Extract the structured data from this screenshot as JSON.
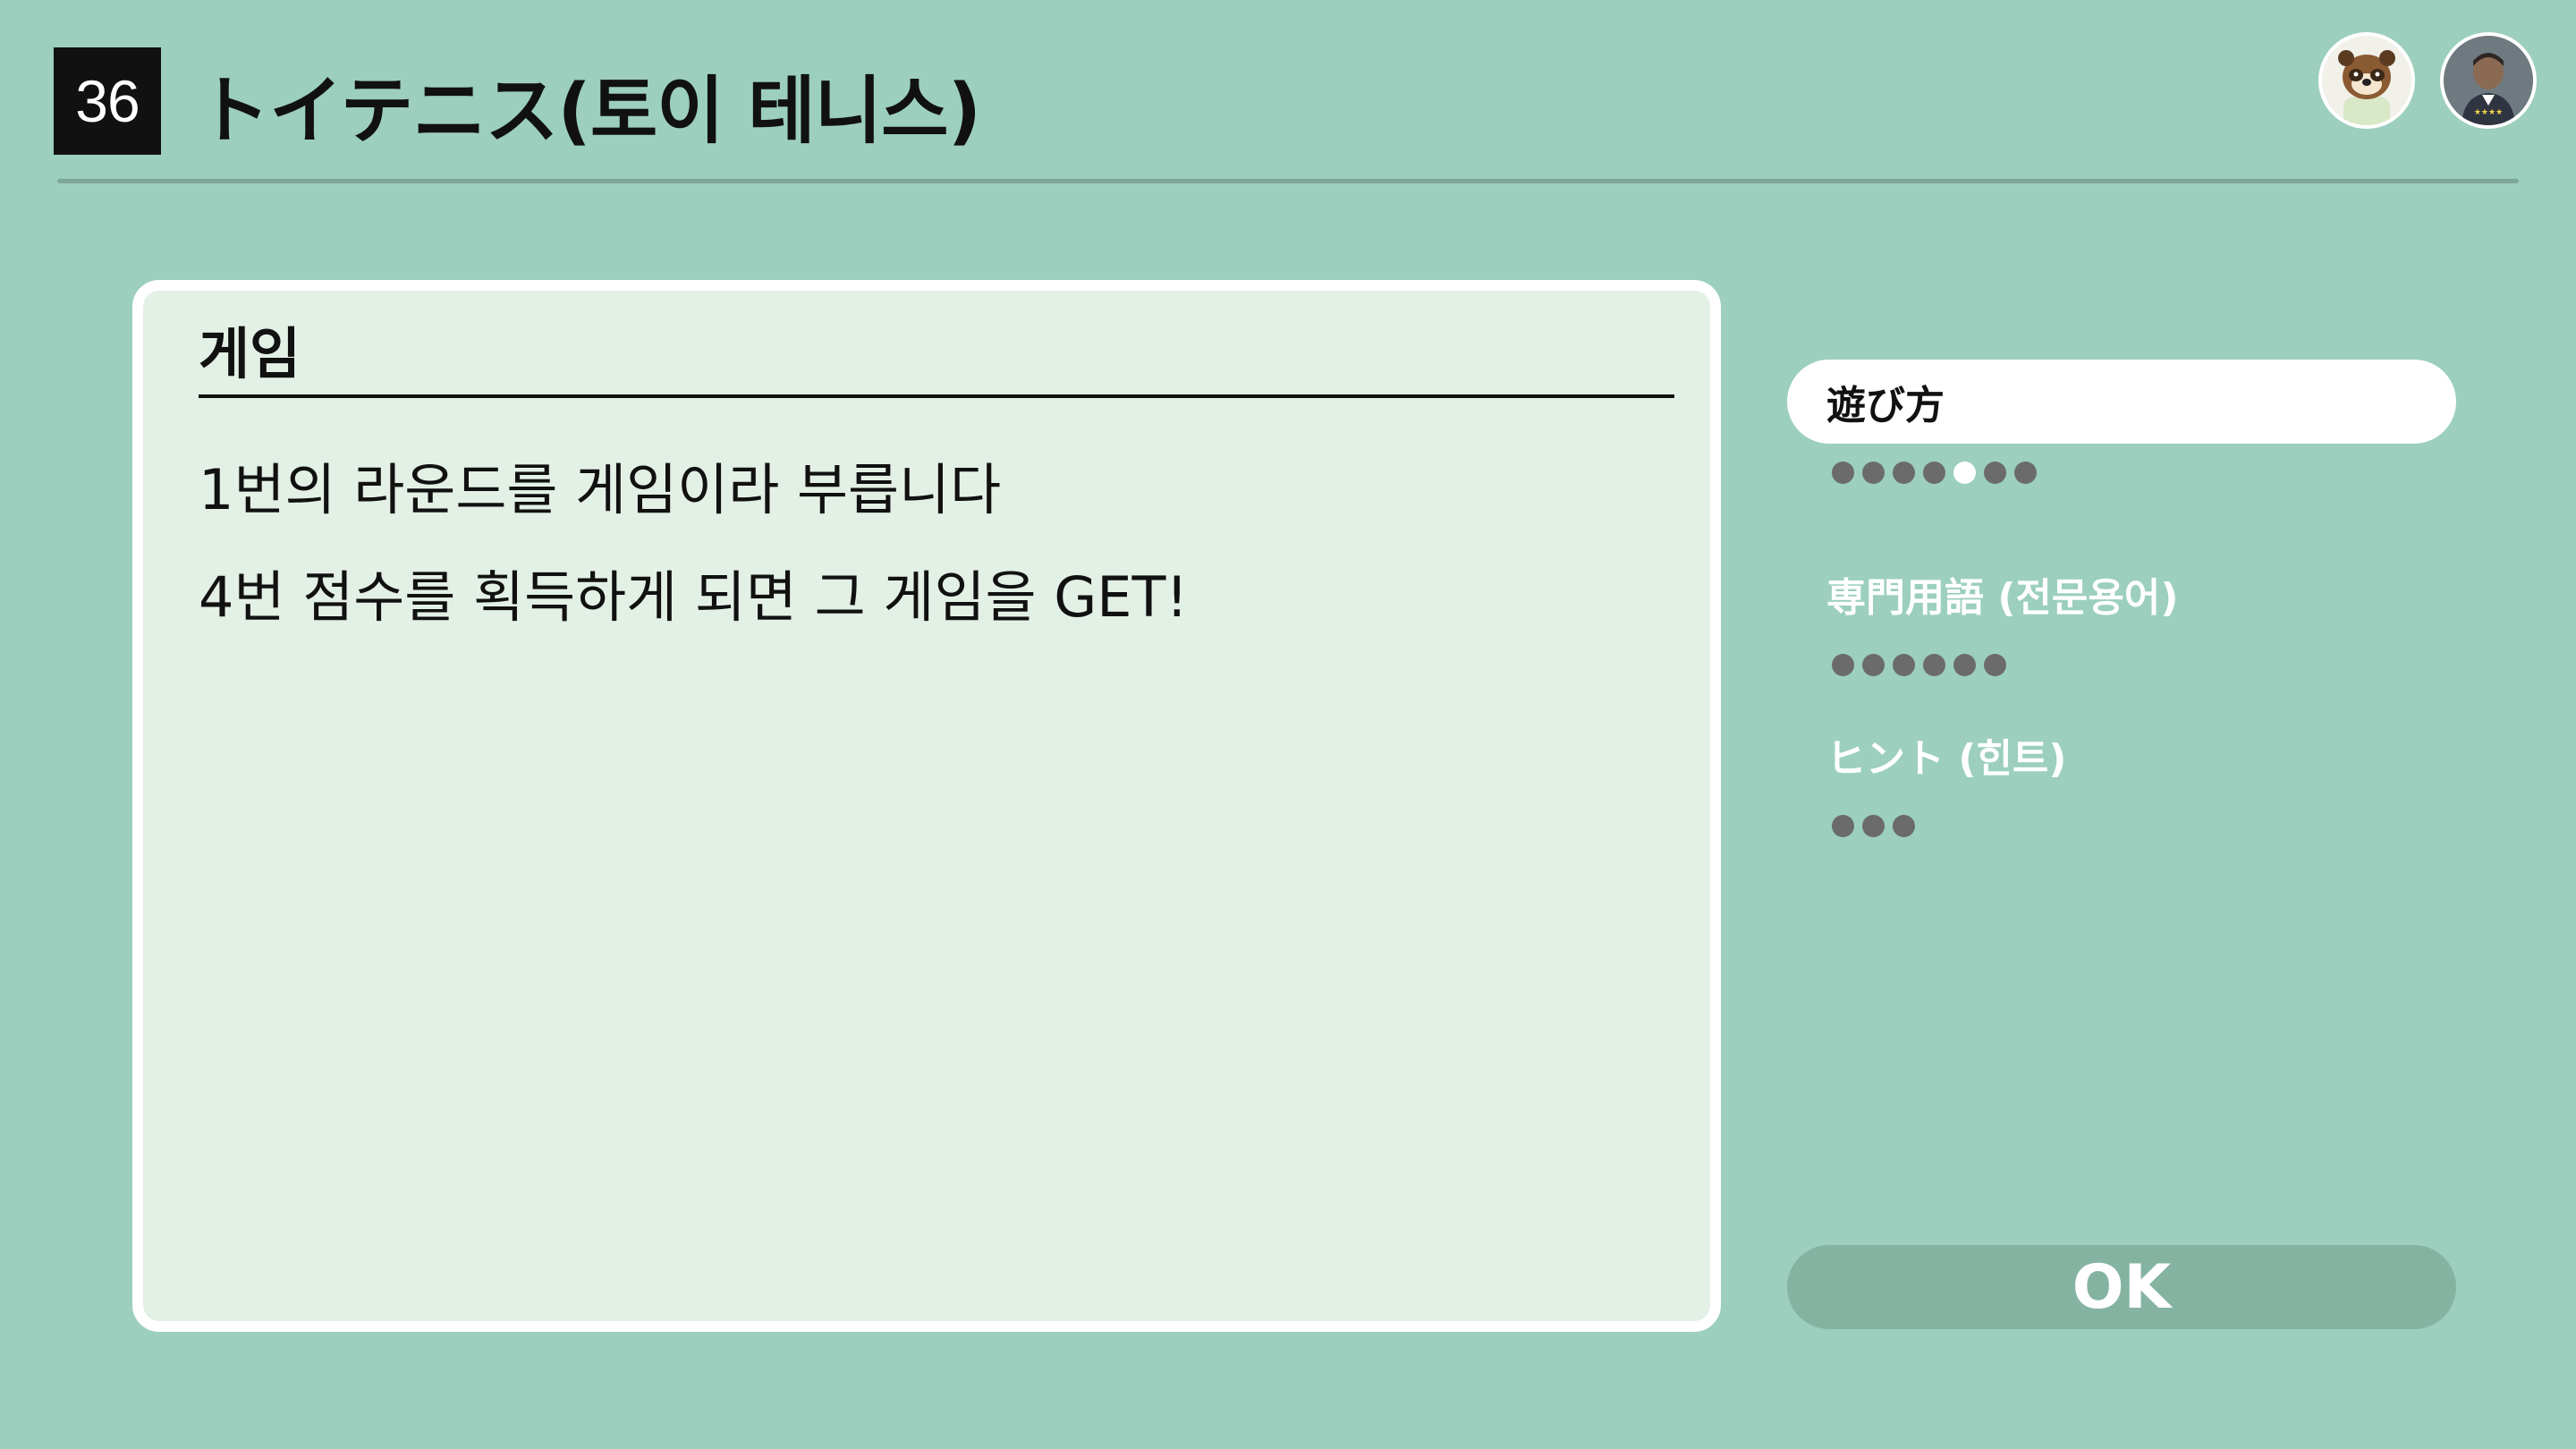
{
  "header": {
    "number": "36",
    "title": "トイテニス(토이 테니스)"
  },
  "avatars": {
    "npc_icon": "tanuki-npc-avatar",
    "player_icon": "player-avatar"
  },
  "content": {
    "heading": "게임",
    "lines": [
      "1번의 라운드를 게임이라 부릅니다",
      "4번 점수를 획득하게 되면 그 게임을 GET!"
    ]
  },
  "sidebar": {
    "items": [
      {
        "label": "遊び方",
        "active": true,
        "pages": 7,
        "current_page": 5
      },
      {
        "label": "専門用語 (전문용어)",
        "active": false,
        "pages": 6
      },
      {
        "label": "ヒント (힌트)",
        "active": false,
        "pages": 3
      }
    ]
  },
  "ok_button": {
    "label": "OK"
  },
  "colors": {
    "background": "#9ccfbd",
    "card": "#e3f0e6",
    "ok_button": "#85b3a2",
    "dot": "#6b6b6b",
    "dot_current": "#ffffff"
  }
}
